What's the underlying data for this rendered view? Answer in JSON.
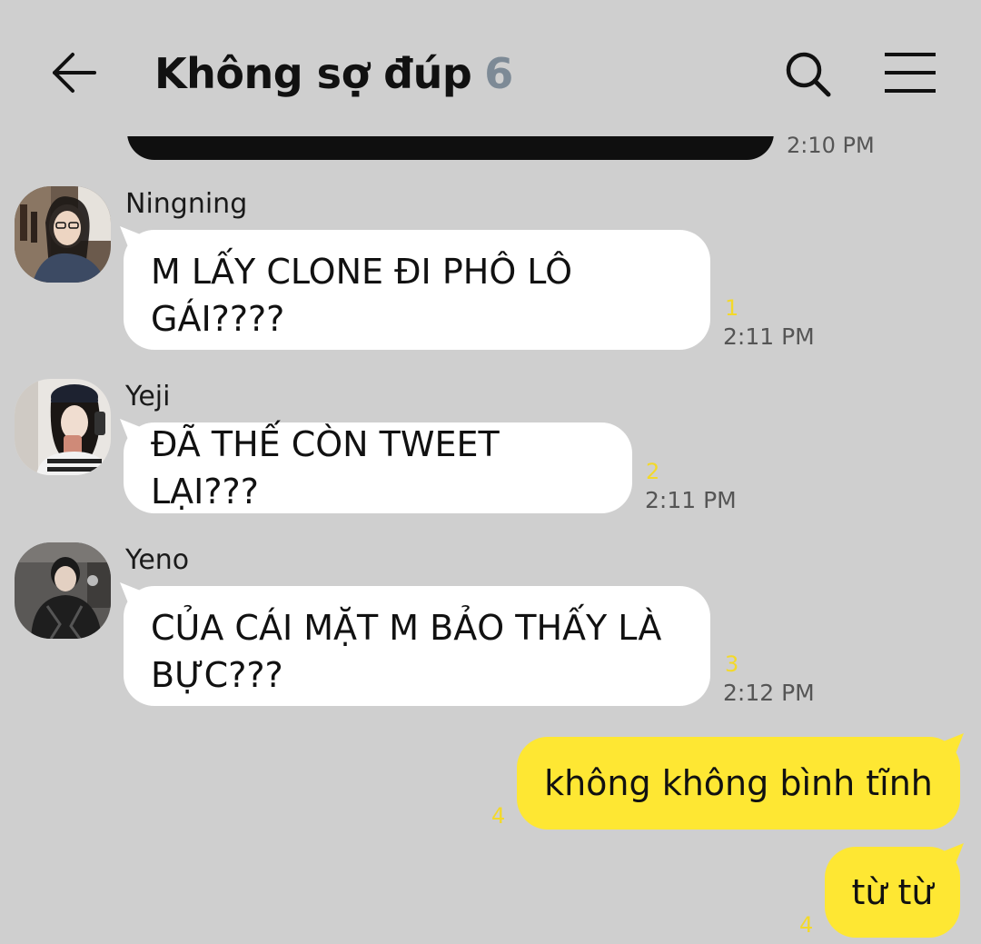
{
  "header": {
    "title": "Không sợ đúp",
    "member_count": "6",
    "back_icon": "arrow-left-icon",
    "search_icon": "search-icon",
    "menu_icon": "hamburger-menu-icon"
  },
  "previous_message": {
    "time": "2:10 PM"
  },
  "messages": [
    {
      "sender": "Ningning",
      "line1": "M LẤY CLONE ĐI PHÔ LÔ",
      "line2": "GÁI????",
      "unread": "1",
      "time": "2:11 PM"
    },
    {
      "sender": "Yeji",
      "line1": "ĐÃ THẾ CÒN TWEET LẠI???",
      "unread": "2",
      "time": "2:11 PM"
    },
    {
      "sender": "Yeno",
      "line1": "CỦA CÁI MẶT M BẢO THẤY LÀ",
      "line2": "BỰC???",
      "unread": "3",
      "time": "2:12 PM"
    }
  ],
  "my_messages": [
    {
      "text": "không không bình tĩnh",
      "unread": "4"
    },
    {
      "text": "từ từ",
      "unread": "4"
    }
  ],
  "colors": {
    "background": "#cfcfcf",
    "incoming_bubble": "#ffffff",
    "outgoing_bubble": "#fee733",
    "unread_count": "#f3d92a",
    "member_count": "#7d8a96"
  }
}
